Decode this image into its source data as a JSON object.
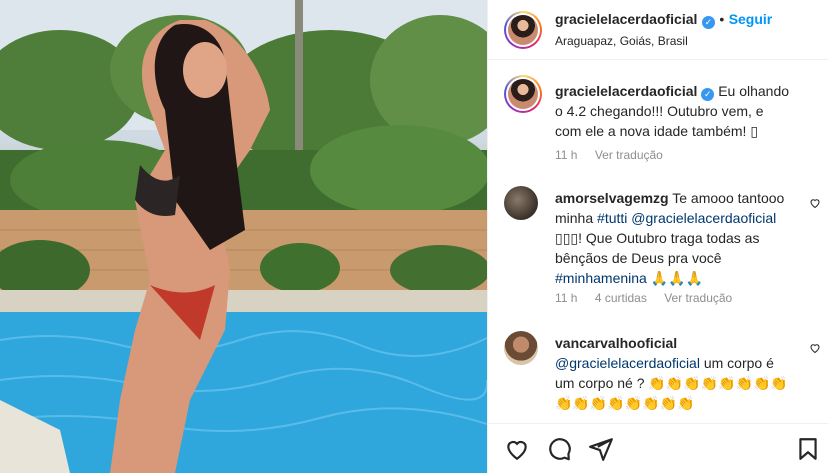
{
  "post": {
    "author": "gracielelacerdaoficial",
    "verified_mark": "✓",
    "separator": "•",
    "follow_label": "Seguir",
    "location": "Araguapaz, Goiás, Brasil",
    "more_icon": "more-options-icon"
  },
  "caption": {
    "user": "gracielelacerdaoficial",
    "text": "Eu olhando o 4.2 chegando!!! Outubro vem, e com ele a nova idade também! ▯",
    "time": "11 h",
    "translate": "Ver tradução"
  },
  "comments": [
    {
      "user": "amorselvagemzg",
      "text_before": "Te amooo tantooo minha ",
      "tag1": "#tutti",
      "mention": "@gracielelacerdaoficial",
      "text_after": "▯▯▯! Que Outubro traga todas as bênçãos de Deus pra você",
      "tag2": "#minhamenina",
      "emojis": "🙏🙏🙏",
      "time": "11 h",
      "likes": "4 curtidas",
      "translate": "Ver tradução"
    },
    {
      "user": "vancarvalhooficial",
      "mention": "@gracielelacerdaoficial",
      "text": "um corpo é um corpo né ?",
      "emojis": "👏👏👏👏👏👏👏👏👏👏👏👏👏👏👏👏"
    }
  ],
  "colors": {
    "link": "#00376b",
    "follow": "#0095f6",
    "meta": "#8e8e8e",
    "verified": "#3897f0"
  },
  "actions": [
    "like-icon",
    "comment-icon",
    "share-icon",
    "save-icon"
  ]
}
